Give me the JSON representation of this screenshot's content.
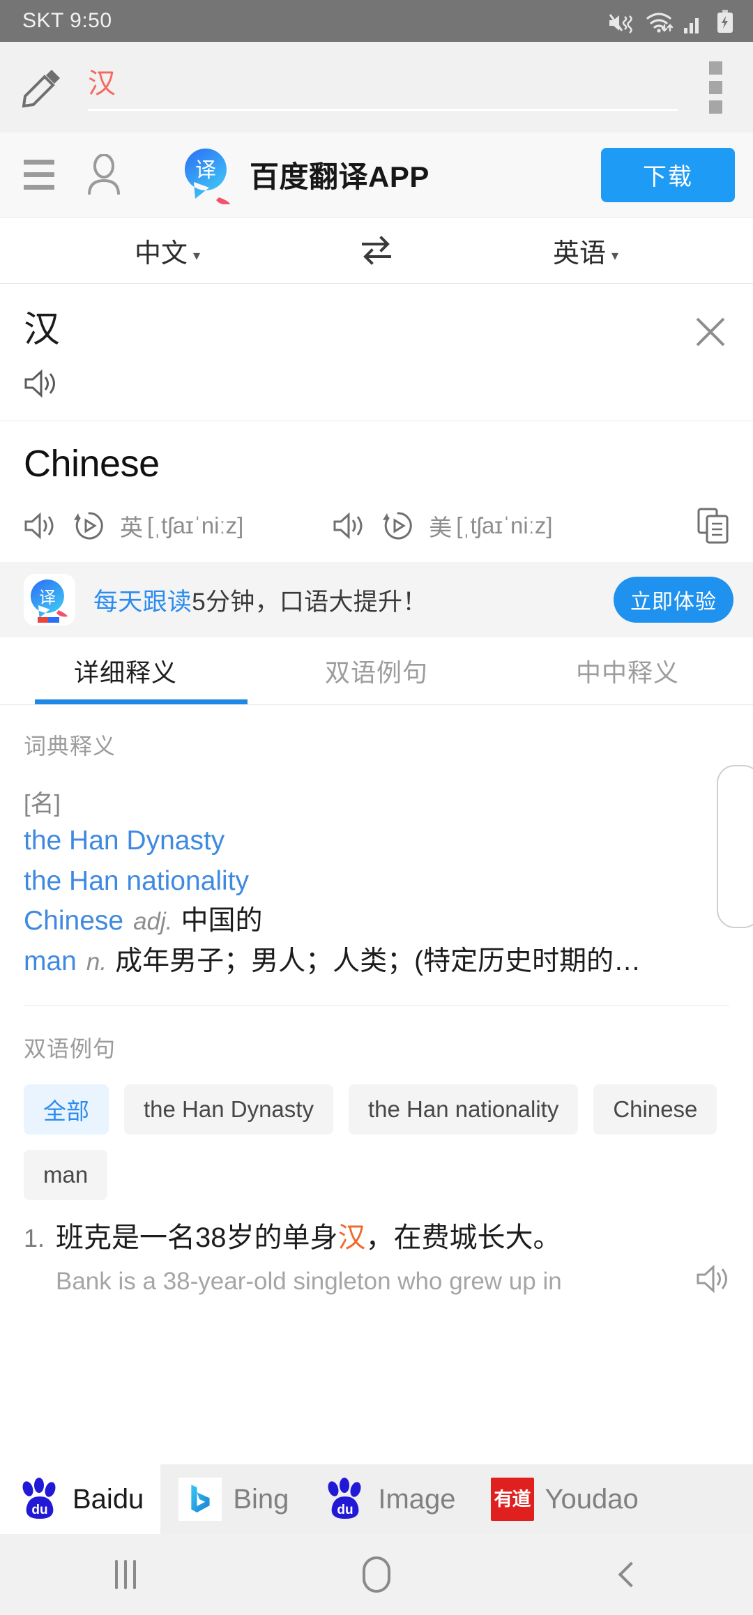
{
  "status_bar": {
    "carrier_time": "SKT 9:50",
    "icons": [
      "mute-vibrate-icon",
      "wifi-icon",
      "signal-icon",
      "battery-charging-icon"
    ]
  },
  "browser": {
    "edit_icon": "pencil-icon",
    "url_value": "汉",
    "menu_icon": "kebab-menu-icon"
  },
  "app_banner": {
    "menu_icon": "hamburger-icon",
    "account_icon": "person-icon",
    "logo_glyph": "译",
    "title": "百度翻译APP",
    "download_label": "下载",
    "accent": "#1e9bf5"
  },
  "language_row": {
    "source": "中文",
    "target": "英语",
    "caret": "▾",
    "swap_icon": "swap-arrows-icon"
  },
  "query": {
    "word": "汉",
    "speaker_icon": "speaker-icon",
    "close_icon": "close-icon"
  },
  "result": {
    "word": "Chinese",
    "pronunciations": [
      {
        "region": "英",
        "ipa": "[ˌtʃaɪˈniːz]",
        "speaker_icon": "speaker-icon",
        "replay_icon": "replay-icon"
      },
      {
        "region": "美",
        "ipa": "[ˌtʃaɪˈniːz]",
        "speaker_icon": "speaker-icon",
        "replay_icon": "replay-icon"
      }
    ],
    "copy_icon": "copy-icon"
  },
  "promo": {
    "logo_glyph": "译",
    "highlight": "每天跟读",
    "rest": "5分钟，口语大提升！",
    "button_label": "立即体验",
    "highlight_color": "#2b8cf0"
  },
  "tabs": [
    {
      "label": "详细释义",
      "active": true
    },
    {
      "label": "双语例句",
      "active": false
    },
    {
      "label": "中中释义",
      "active": false
    }
  ],
  "definitions": {
    "section_label": "词典释义",
    "pos_tag": "[名]",
    "entries": [
      {
        "en": "the Han Dynasty",
        "pos": "",
        "cn": ""
      },
      {
        "en": "the Han nationality",
        "pos": "",
        "cn": ""
      },
      {
        "en": "Chinese",
        "pos": "adj.",
        "cn": "中国的"
      },
      {
        "en": "man",
        "pos": "n.",
        "cn": "成年男子；男人；人类；(特定历史时期的…"
      }
    ]
  },
  "examples": {
    "section_label": "双语例句",
    "filters": [
      {
        "label": "全部",
        "active": true
      },
      {
        "label": "the Han Dynasty",
        "active": false
      },
      {
        "label": "the Han nationality",
        "active": false
      },
      {
        "label": "Chinese",
        "active": false
      },
      {
        "label": "man",
        "active": false
      }
    ],
    "items": [
      {
        "number": "1.",
        "cn_before": "班克是一名38岁的单身",
        "cn_mark": "汉",
        "cn_after": "，在费城长大。",
        "en": "Bank is a 38-year-old singleton who grew up in",
        "speaker_icon": "speaker-icon"
      }
    ]
  },
  "engine_bar": [
    {
      "name": "Baidu",
      "icon": "baidu-paw-icon",
      "active": true
    },
    {
      "name": "Bing",
      "icon": "bing-icon",
      "active": false
    },
    {
      "name": "Image",
      "icon": "baidu-paw-icon",
      "active": false
    },
    {
      "name": "Youdao",
      "icon": "youdao-icon",
      "glyph": "有道",
      "active": false
    }
  ],
  "nav_bar": {
    "recents": "recents-icon",
    "home": "home-icon",
    "back": "back-icon"
  }
}
